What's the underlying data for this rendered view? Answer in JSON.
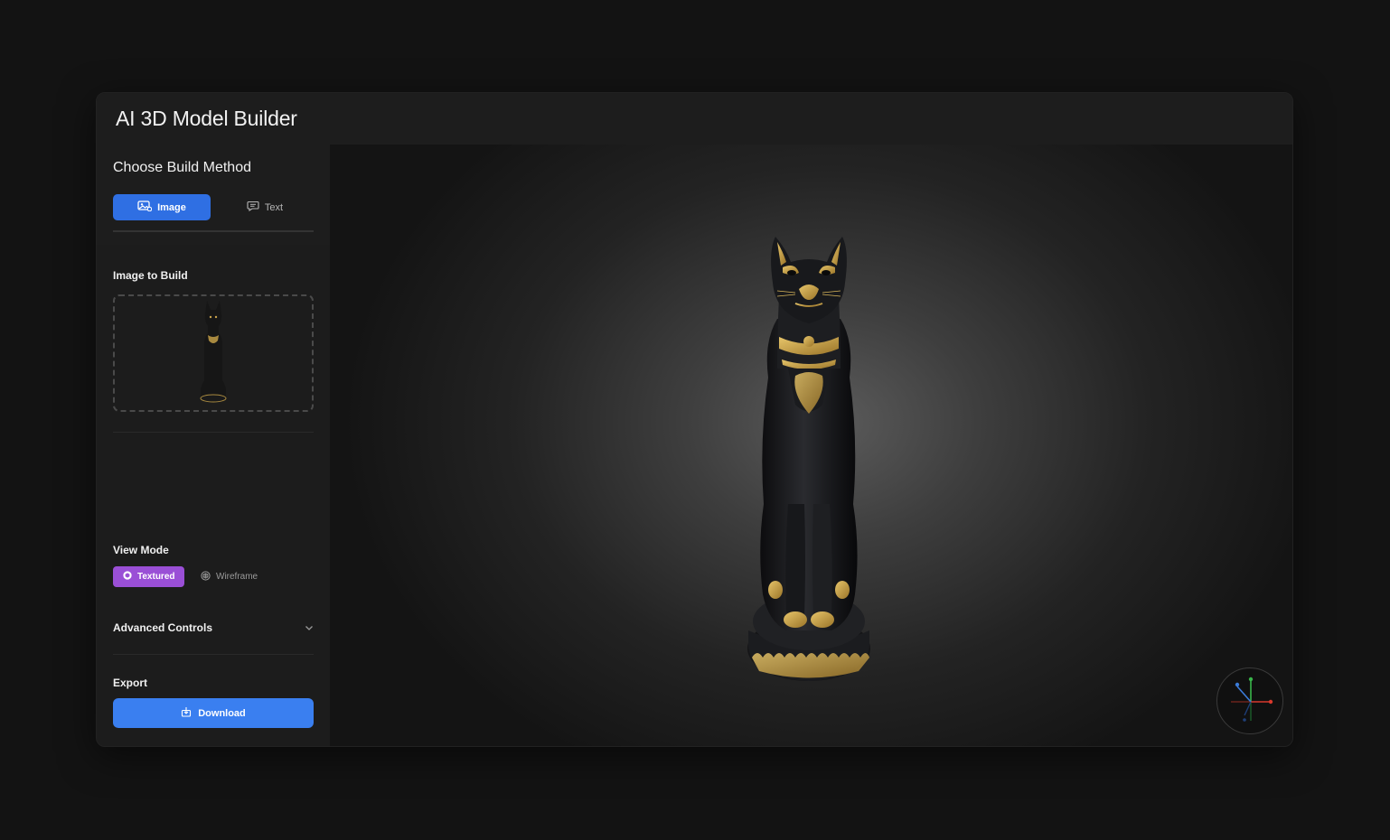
{
  "app": {
    "title": "AI 3D Model Builder"
  },
  "sidebar": {
    "build_method": {
      "heading": "Choose Build Method",
      "options": [
        {
          "label": "Image",
          "icon": "image-icon",
          "selected": true
        },
        {
          "label": "Text",
          "icon": "message-icon",
          "selected": false
        }
      ]
    },
    "image_to_build": {
      "heading": "Image to Build"
    },
    "view_mode": {
      "heading": "View Mode",
      "options": [
        {
          "label": "Textured",
          "icon": "cube-icon",
          "selected": true
        },
        {
          "label": "Wireframe",
          "icon": "wireframe-icon",
          "selected": false
        }
      ]
    },
    "advanced": {
      "label": "Advanced Controls",
      "expanded": false
    },
    "export": {
      "heading": "Export",
      "download_label": "Download"
    }
  },
  "colors": {
    "primary": "#2f6fe3",
    "download": "#3a7ff0",
    "view_mode_accent": "#9a4fd6",
    "background": "#131313",
    "panel": "#1c1c1c"
  }
}
